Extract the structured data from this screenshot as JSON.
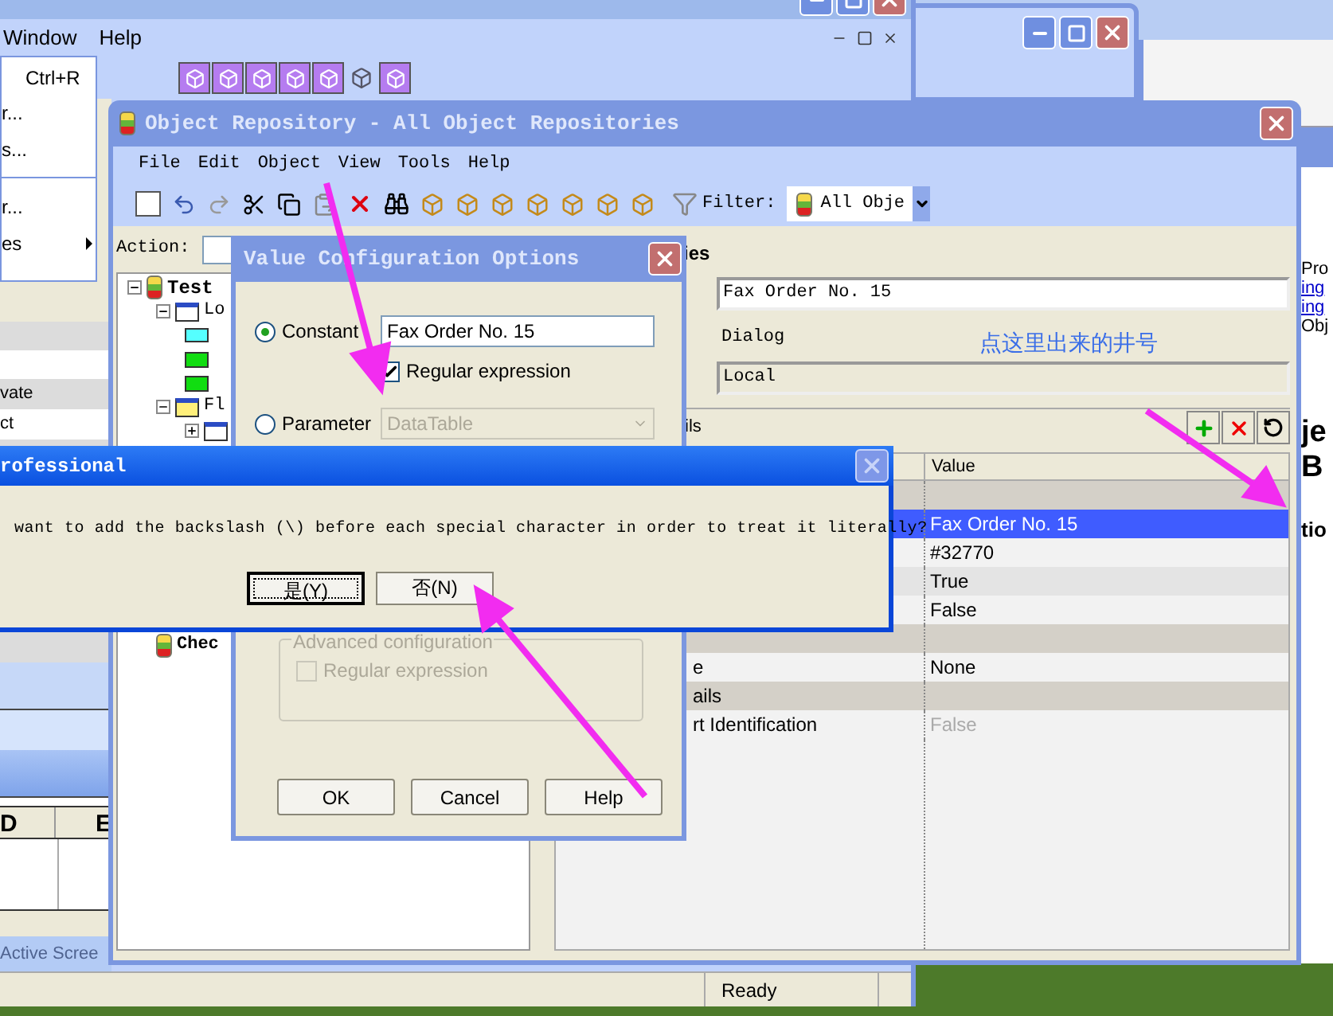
{
  "main_window": {
    "menu": [
      {
        "label": "Window"
      },
      {
        "label": "Help"
      }
    ],
    "open_menu": {
      "items": [
        {
          "kind": "shortcut",
          "label": "Ctrl+R"
        },
        {
          "kind": "item",
          "label": "r...",
          "submenu": false
        },
        {
          "kind": "item",
          "label": "s...",
          "submenu": false
        },
        {
          "kind": "separator"
        },
        {
          "kind": "item",
          "label": "r...",
          "submenu": false
        },
        {
          "kind": "item",
          "label": "es",
          "submenu": true
        }
      ]
    },
    "panel_rows": [
      "vate",
      "ct"
    ],
    "grid_columns": [
      "D",
      "E"
    ],
    "tab_label": "Active Scree",
    "status": "Ready"
  },
  "side_window": {
    "lines": [
      {
        "kind": "text",
        "text": "Pro"
      },
      {
        "kind": "link",
        "text": "ing"
      },
      {
        "kind": "link",
        "text": "ing"
      },
      {
        "kind": "text",
        "text": "Obj"
      },
      {
        "kind": "heading",
        "text": "je"
      },
      {
        "kind": "heading",
        "text": "B"
      },
      {
        "kind": "subheading",
        "text": "tio"
      }
    ]
  },
  "object_repository": {
    "title": "Object Repository - All Object Repositories",
    "menu": [
      "File",
      "Edit",
      "Object",
      "View",
      "Tools",
      "Help"
    ],
    "filter_label": "Filter:",
    "filter_value": "All Obje",
    "action_label": "Action:",
    "tree": [
      {
        "label": "Test",
        "kind": "repository",
        "expanded": true,
        "children": [
          {
            "label": "Lo",
            "kind": "dialog",
            "expanded": true,
            "children": [
              {
                "kind": "field"
              },
              {
                "kind": "edit"
              },
              {
                "kind": "edit"
              }
            ]
          },
          {
            "label": "Fl",
            "kind": "window",
            "expanded": true,
            "children": [
              {
                "kind": "dialog",
                "expanded": false
              }
            ]
          },
          {
            "label": "Chec",
            "kind": "repository"
          }
        ]
      }
    ],
    "properties_header": "ies",
    "name_value": "Fax Order No. 15",
    "class_label": "Dialog",
    "repository_value": "Local",
    "details_label": "ils",
    "value_column": "Value",
    "rows": [
      {
        "kind": "group"
      },
      {
        "kind": "property",
        "value": "Fax Order No. 15",
        "selected": true,
        "disabled": false
      },
      {
        "kind": "property",
        "value": "#32770",
        "selected": false,
        "disabled": false
      },
      {
        "kind": "property",
        "value": "True",
        "selected": false,
        "disabled": false
      },
      {
        "kind": "property",
        "value": "False",
        "selected": false,
        "disabled": false
      },
      {
        "kind": "group"
      },
      {
        "kind": "property",
        "name": "e",
        "value": "None",
        "selected": false,
        "disabled": false
      },
      {
        "kind": "group",
        "name": "ails"
      },
      {
        "kind": "property",
        "name": "rt Identification",
        "value": "False",
        "selected": false,
        "disabled": true
      }
    ]
  },
  "annotation": "点这里出来的井号",
  "value_dialog": {
    "title": "Value Configuration Options",
    "options": [
      {
        "label": "Constant",
        "selected": true,
        "value": "Fax Order No. 15",
        "disabled": false
      },
      {
        "label": "Parameter",
        "selected": false,
        "value": "DataTable",
        "disabled": true
      }
    ],
    "regex": {
      "label": "Regular expression",
      "checked": true,
      "disabled": false
    },
    "advanced": {
      "title": "Advanced configuration",
      "label": "Regular expression",
      "checked": false,
      "disabled": true
    },
    "buttons": [
      "OK",
      "Cancel",
      "Help"
    ]
  },
  "message_box": {
    "title": "rofessional",
    "text": "want to add the backslash (\\) before each special character in order to treat it literally?",
    "buttons": [
      {
        "label": "是(Y)",
        "focused": true
      },
      {
        "label": "否(N)",
        "focused": false
      }
    ]
  }
}
